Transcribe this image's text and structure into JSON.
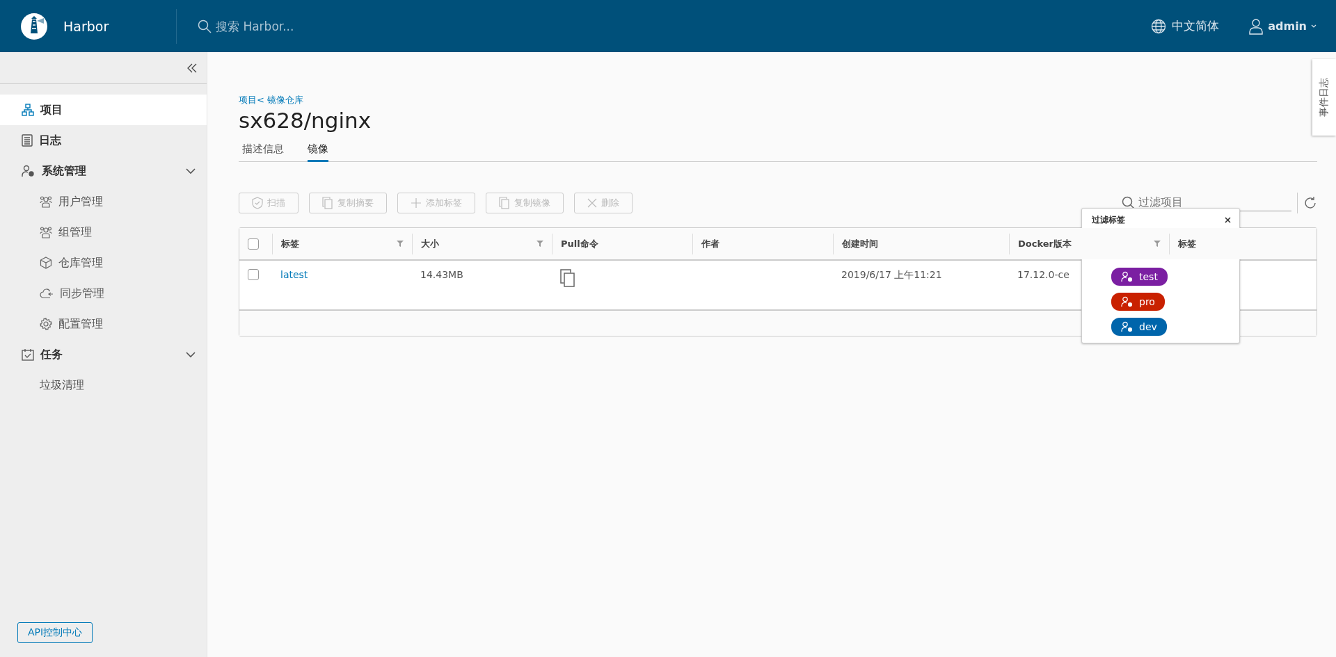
{
  "header": {
    "brand": "Harbor",
    "search": {
      "placeholder": "搜索 Harbor..."
    },
    "language": "中文简体",
    "user": "admin"
  },
  "sidebar": {
    "items": [
      {
        "label": "项目",
        "selected": true
      },
      {
        "label": "日志",
        "selected": false
      },
      {
        "label": "系统管理",
        "selected": false,
        "expanded": true,
        "children": [
          {
            "label": "用户管理",
            "selected": false
          },
          {
            "label": "组管理",
            "selected": false
          },
          {
            "label": "仓库管理",
            "selected": false
          },
          {
            "label": "同步管理",
            "selected": false
          },
          {
            "label": "配置管理",
            "selected": false
          }
        ]
      },
      {
        "label": "任务",
        "selected": false,
        "expanded": true,
        "children": [
          {
            "label": "垃圾清理",
            "selected": false
          }
        ]
      }
    ],
    "api_button": "API控制中心"
  },
  "breadcrumb": "项目< 镜像仓库",
  "title": "sx628/nginx",
  "tabs": [
    {
      "label": "描述信息",
      "selected": false
    },
    {
      "label": "镜像",
      "selected": true
    }
  ],
  "toolbar": {
    "buttons": [
      {
        "label": "扫描",
        "kind": "scan",
        "disabled": true
      },
      {
        "label": "复制摘要",
        "kind": "copy",
        "disabled": true
      },
      {
        "label": "添加标签",
        "kind": "add",
        "disabled": true
      },
      {
        "label": "复制镜像",
        "kind": "copy",
        "disabled": true
      },
      {
        "label": "删除",
        "kind": "delete",
        "disabled": true
      }
    ],
    "filter": {
      "placeholder": "过滤项目"
    }
  },
  "table": {
    "columns": [
      {
        "label": "标签",
        "filterable": true
      },
      {
        "label": "大小",
        "filterable": true
      },
      {
        "label": "Pull命令",
        "filterable": false
      },
      {
        "label": "作者",
        "filterable": false
      },
      {
        "label": "创建时间",
        "filterable": false
      },
      {
        "label": "Docker版本",
        "filterable": true
      },
      {
        "label": "标签",
        "filterable": false
      }
    ],
    "all_checked": false,
    "rows": [
      {
        "checked": false,
        "tag": "latest",
        "size": "14.43MB",
        "created": "2019/6/17 上午11:21",
        "docker": "17.12.0-ce"
      }
    ]
  },
  "label_filter": {
    "title": "过滤标签",
    "labels": [
      {
        "name": "test",
        "color": "#7b1fa2"
      },
      {
        "name": "pro",
        "color": "#c92100"
      },
      {
        "name": "dev",
        "color": "#0065ab"
      }
    ]
  },
  "side_tab": "事件日志"
}
